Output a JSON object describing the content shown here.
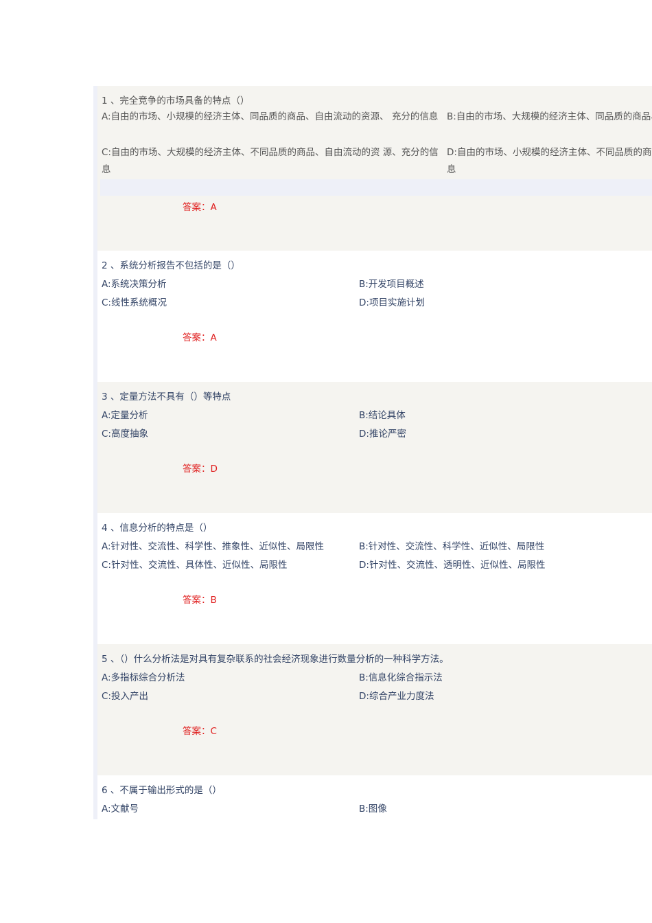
{
  "questions": [
    {
      "title": "1 、完全竞争的市场具备的特点（）",
      "A": "A:自由的市场、小规模的经济主体、同品质的商品、自由流动的资源、 充分的信息",
      "B": "B:自由的市场、大规模的经济主体、同品质的商品、自由流动的资源、充分的信息",
      "C": "C:自由的市场、大规模的经济主体、不同品质的商品、自由流动的资 源、充分的信息",
      "D": "D:自由的市场、小规模的经济主体、不同品质的商品、自由流动的资源、充分的信息",
      "answer": "答案：A"
    },
    {
      "title": "2 、系统分析报告不包括的是（）",
      "A": "A:系统决策分析",
      "B": "B:开发项目概述",
      "C": "C:线性系统概况",
      "D": "D:项目实施计划",
      "answer": "答案：A"
    },
    {
      "title": "3 、定量方法不具有（）等特点",
      "A": "A:定量分析",
      "B": "B:结论具体",
      "C": "C:高度抽象",
      "D": "D:推论严密",
      "answer": "答案：D"
    },
    {
      "title": "4 、信息分析的特点是（）",
      "A": "A:针对性、交流性、科学性、推象性、近似性、局限性",
      "B": "B:针对性、交流性、科学性、近似性、局限性",
      "C": "C:针对性、交流性、具体性、近似性、局限性",
      "D": "D:针对性、交流性、透明性、近似性、局限性",
      "answer": "答案：B"
    },
    {
      "title": "5 、（）什么分析法是对具有复杂联系的社会经济现象进行数量分析的一种科学方法。",
      "A": "A:多指标综合分析法",
      "B": "B:信息化综合指示法",
      "C": "C:投入产出",
      "D": "D:综合产业力度法",
      "answer": "答案：C"
    },
    {
      "title": "6 、不属于输出形式的是（）",
      "A": "A:文献号",
      "B": "B:图像"
    }
  ]
}
